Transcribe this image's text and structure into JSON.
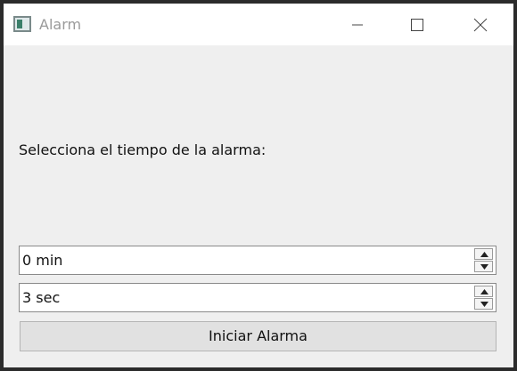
{
  "window": {
    "title": "Alarm",
    "icon": "app-window-icon"
  },
  "titlebar_buttons": {
    "minimize": "minimize-icon",
    "maximize": "maximize-icon",
    "close": "close-icon"
  },
  "main": {
    "prompt": "Selecciona el tiempo de la alarma:",
    "minutes": {
      "value": "0 min",
      "up_icon": "chevron-up-icon",
      "down_icon": "chevron-down-icon"
    },
    "seconds": {
      "value": "3 sec",
      "up_icon": "chevron-up-icon",
      "down_icon": "chevron-down-icon"
    },
    "start_button": "Iniciar Alarma"
  }
}
